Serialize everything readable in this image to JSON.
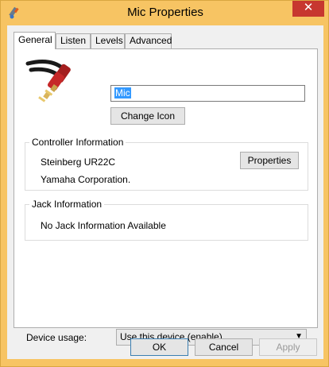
{
  "window": {
    "title": "Mic Properties",
    "close_glyph": "✕"
  },
  "tabs": [
    {
      "label": "General",
      "active": true
    },
    {
      "label": "Listen",
      "active": false
    },
    {
      "label": "Levels",
      "active": false
    },
    {
      "label": "Advanced",
      "active": false
    }
  ],
  "general": {
    "device_name": "Mic",
    "change_icon_label": "Change Icon",
    "device_icon": "rca-cable-icon",
    "controller": {
      "heading": "Controller Information",
      "name": "Steinberg UR22C",
      "manufacturer": "Yamaha Corporation.",
      "properties_label": "Properties"
    },
    "jack": {
      "heading": "Jack Information",
      "message": "No Jack Information Available"
    },
    "device_usage": {
      "label": "Device usage:",
      "selected": "Use this device (enable)"
    }
  },
  "footer": {
    "ok": "OK",
    "cancel": "Cancel",
    "apply": "Apply"
  },
  "colors": {
    "frame": "#f7c463",
    "close": "#c7372f",
    "selection": "#3399ff"
  }
}
